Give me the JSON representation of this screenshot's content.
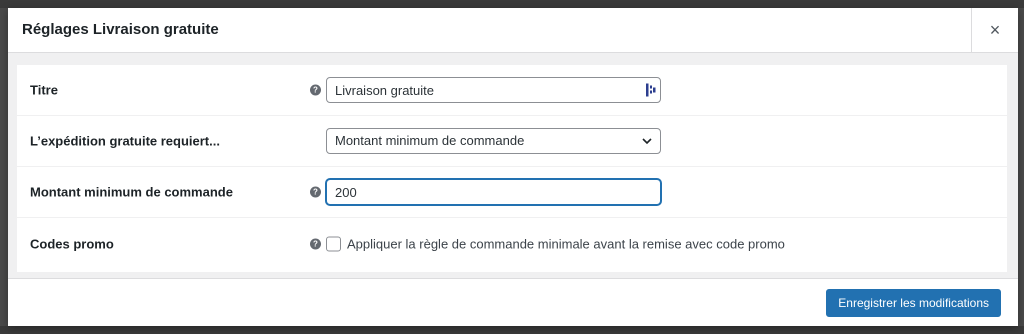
{
  "modal": {
    "title": "Réglages Livraison gratuite",
    "close_label": "×"
  },
  "fields": {
    "title": {
      "label": "Titre",
      "value": "Livraison gratuite"
    },
    "requires": {
      "label": "L’expédition gratuite requiert...",
      "selected": "Montant minimum de commande"
    },
    "min_amount": {
      "label": "Montant minimum de commande",
      "value": "200"
    },
    "promo_codes": {
      "label": "Codes promo",
      "checkbox_label": "Appliquer la règle de commande minimale avant la remise avec code promo",
      "checked": false
    }
  },
  "footer": {
    "save_label": "Enregistrer les modifications"
  },
  "help_icon_glyph": "?",
  "colors": {
    "accent": "#2271b1",
    "backdrop": "#4a4a4a"
  }
}
